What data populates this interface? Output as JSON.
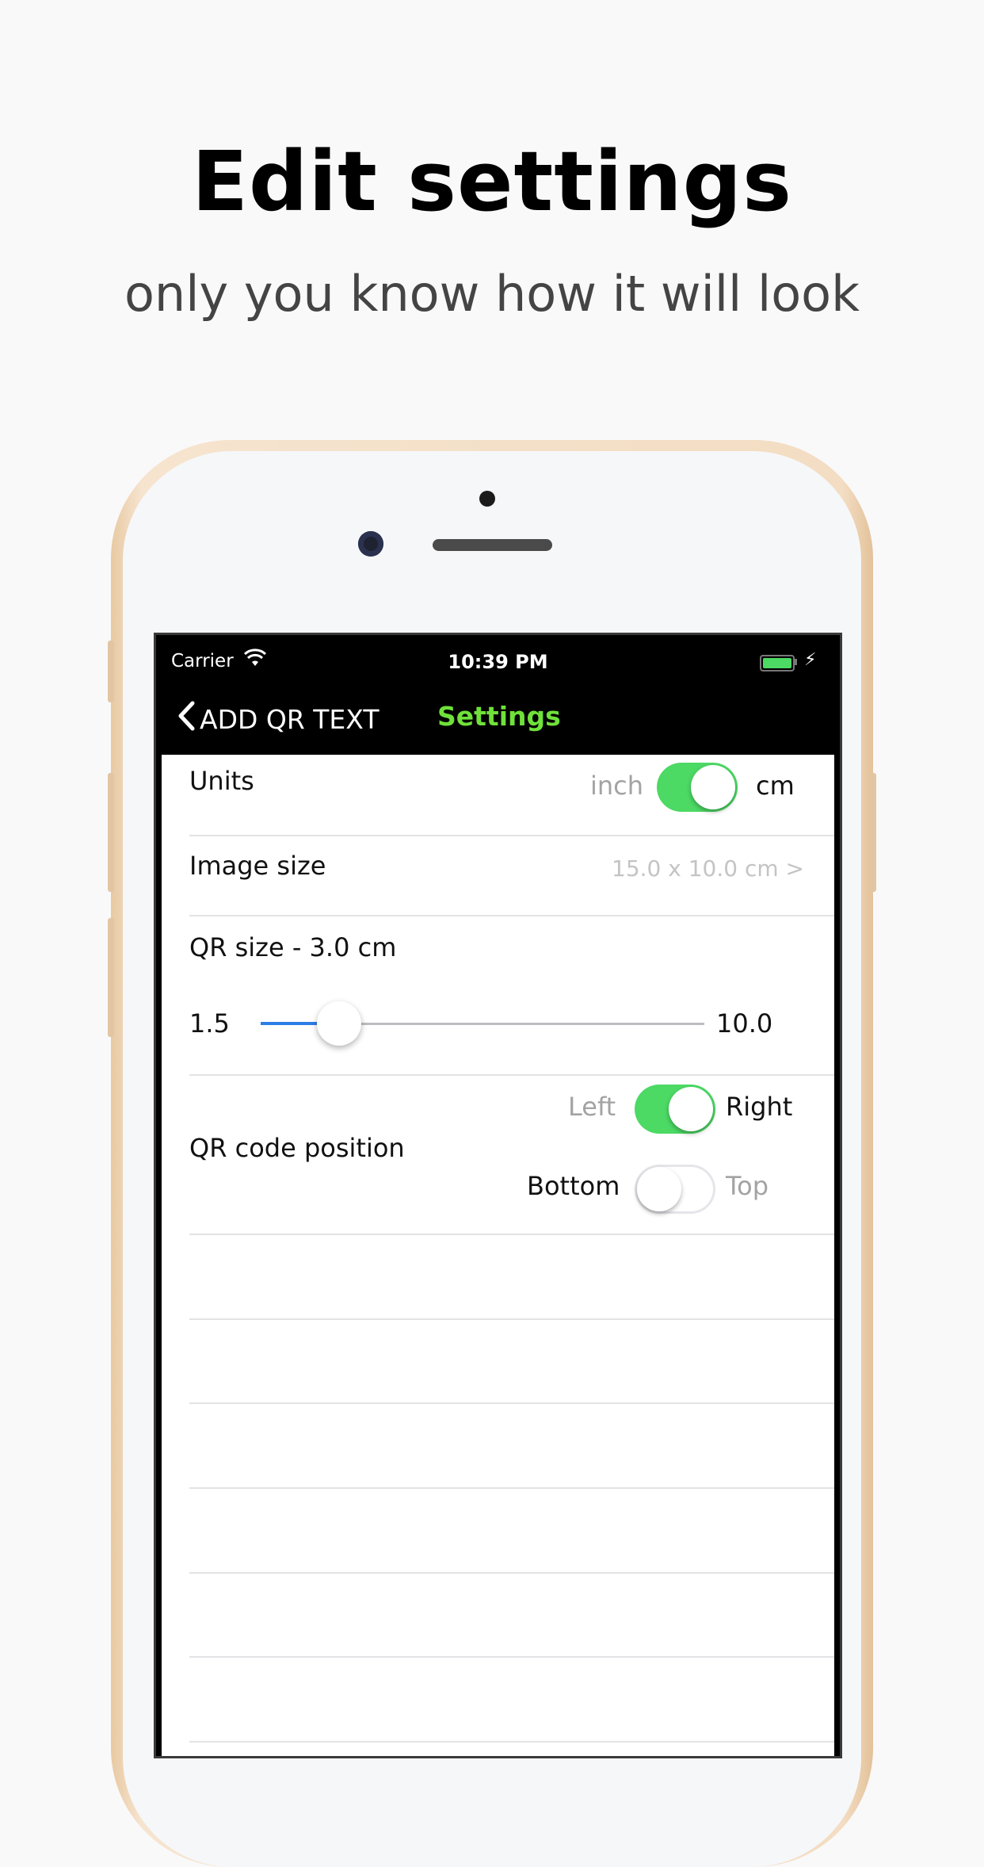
{
  "promo": {
    "headline": "Edit settings",
    "subheadline": "only you know how it will look"
  },
  "status_bar": {
    "carrier": "Carrier",
    "time": "10:39 PM"
  },
  "nav": {
    "back_label": "ADD QR TEXT",
    "title": "Settings"
  },
  "settings": {
    "units": {
      "label": "Units",
      "option_left": "inch",
      "option_right": "cm",
      "selected": "cm"
    },
    "image_size": {
      "label": "Image size",
      "value": "15.0 x 10.0 cm >"
    },
    "qr_size": {
      "label": "QR size - 3.0 cm",
      "min_label": "1.5",
      "max_label": "10.0",
      "min": 1.5,
      "max": 10.0,
      "value": 3.0
    },
    "qr_position": {
      "label": "QR code position",
      "horizontal_left": "Left",
      "horizontal_right": "Right",
      "horizontal_selected": "Right",
      "vertical_left": "Bottom",
      "vertical_right": "Top",
      "vertical_selected": "Bottom"
    }
  },
  "colors": {
    "accent_green": "#6fe13a",
    "toggle_on": "#4cd964",
    "slider_blue": "#2d7de6"
  }
}
